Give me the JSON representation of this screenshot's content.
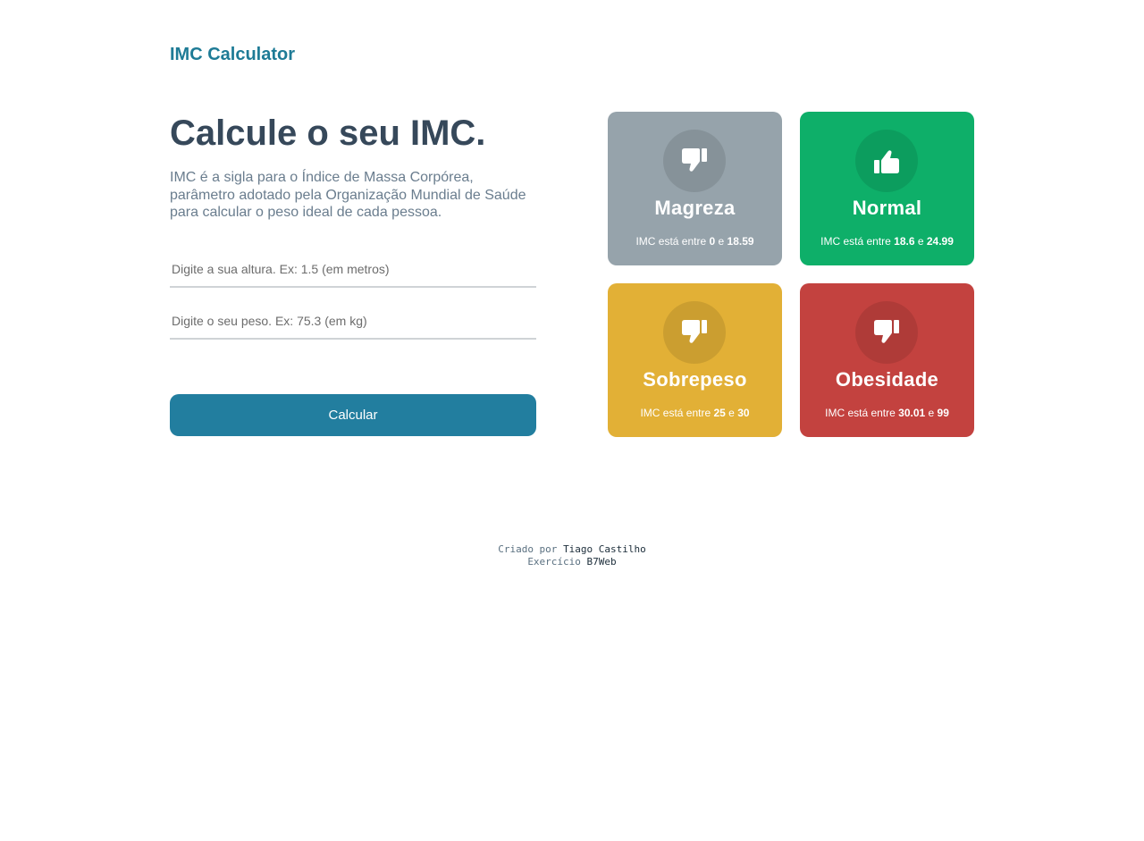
{
  "header": {
    "logo": "IMC Calculator"
  },
  "main": {
    "title": "Calcule o seu IMC.",
    "description": "IMC é a sigla para o Índice de Massa Corpórea, parâmetro adotado pela Organização Mundial de Saúde para calcular o peso ideal de cada pessoa.",
    "height_input": {
      "value": "",
      "placeholder": "Digite a sua altura. Ex: 1.5 (em metros)"
    },
    "weight_input": {
      "value": "",
      "placeholder": "Digite o seu peso. Ex: 75.3 (em kg)"
    },
    "calc_button": "Calcular"
  },
  "cards": [
    {
      "title": "Magreza",
      "icon": "thumbs-down-icon",
      "color": "#96a3ab",
      "prefix": "IMC está entre ",
      "min": "0",
      "sep": " e ",
      "max": "18.59"
    },
    {
      "title": "Normal",
      "icon": "thumbs-up-icon",
      "color": "#0eaf69",
      "prefix": "IMC está entre ",
      "min": "18.6",
      "sep": " e ",
      "max": "24.99"
    },
    {
      "title": "Sobrepeso",
      "icon": "thumbs-down-icon",
      "color": "#e2b036",
      "prefix": "IMC está entre ",
      "min": "25",
      "sep": " e ",
      "max": "30"
    },
    {
      "title": "Obesidade",
      "icon": "thumbs-down-icon",
      "color": "#c3423f",
      "prefix": "IMC está entre ",
      "min": "30.01",
      "sep": " e ",
      "max": "99"
    }
  ],
  "footer": {
    "line1_prefix": "Criado por ",
    "author": "Tiago Castilho",
    "line2_prefix": "Exercício ",
    "school": "B7Web"
  }
}
